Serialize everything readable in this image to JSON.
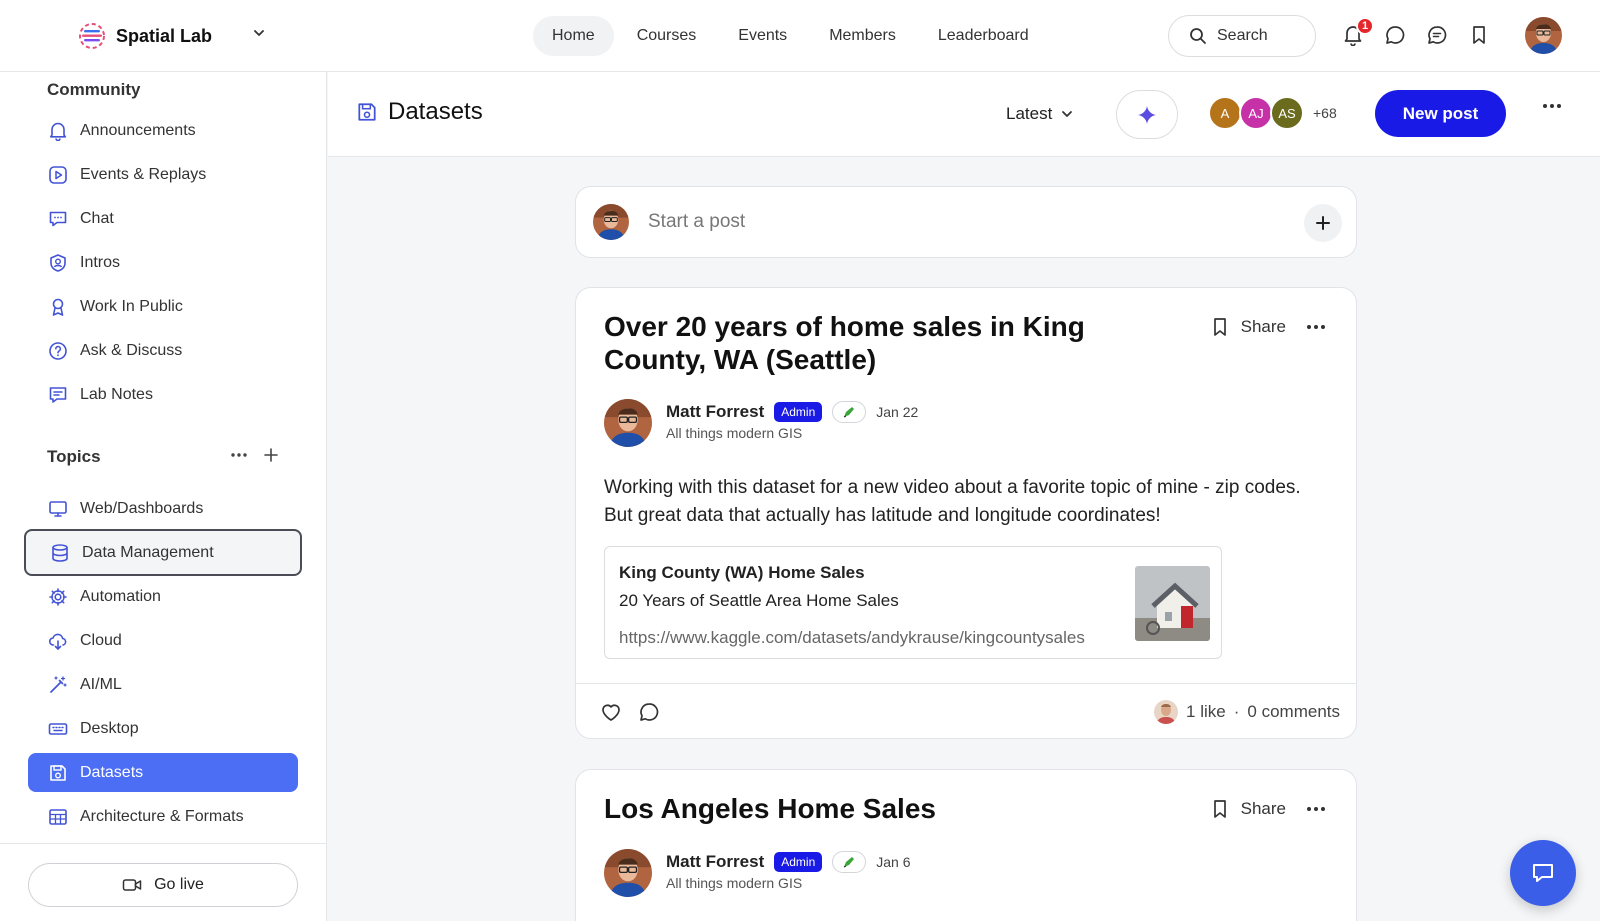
{
  "brand": {
    "name": "Spatial Lab"
  },
  "nav": [
    {
      "label": "Home"
    },
    {
      "label": "Courses"
    },
    {
      "label": "Events"
    },
    {
      "label": "Members"
    },
    {
      "label": "Leaderboard"
    }
  ],
  "search": {
    "label": "Search"
  },
  "notifications": {
    "count": "1"
  },
  "sidebar": {
    "community_heading": "Community",
    "community": [
      {
        "label": "Announcements",
        "icon": "bell-icon"
      },
      {
        "label": "Events & Replays",
        "icon": "play-icon"
      },
      {
        "label": "Chat",
        "icon": "chat-bubble-icon"
      },
      {
        "label": "Intros",
        "icon": "user-shield-icon"
      },
      {
        "label": "Work In Public",
        "icon": "ribbon-icon"
      },
      {
        "label": "Ask & Discuss",
        "icon": "question-icon"
      },
      {
        "label": "Lab Notes",
        "icon": "notes-icon"
      }
    ],
    "topics_heading": "Topics",
    "topics": [
      {
        "label": "Web/Dashboards",
        "icon": "monitor-icon"
      },
      {
        "label": "Data Management",
        "icon": "database-icon"
      },
      {
        "label": "Automation",
        "icon": "gear-icon"
      },
      {
        "label": "Cloud",
        "icon": "cloud-download-icon"
      },
      {
        "label": "AI/ML",
        "icon": "magic-wand-icon"
      },
      {
        "label": "Desktop",
        "icon": "keyboard-icon"
      },
      {
        "label": "Datasets",
        "icon": "floppy-icon"
      },
      {
        "label": "Architecture & Formats",
        "icon": "table-icon"
      }
    ],
    "go_live": "Go live"
  },
  "space": {
    "title": "Datasets",
    "sort": "Latest",
    "members": [
      {
        "initials": "A",
        "color": "#b5731a"
      },
      {
        "initials": "AJ",
        "color": "#c631a8"
      },
      {
        "initials": "AS",
        "color": "#6b6b1e"
      }
    ],
    "members_more": "+68",
    "new_post": "New post"
  },
  "composer": {
    "placeholder": "Start a post"
  },
  "posts": [
    {
      "title": "Over 20 years of home sales in King County, WA (Seattle)",
      "share": "Share",
      "author": "Matt Forrest",
      "badge": "Admin",
      "date": "Jan 22",
      "bio": "All things modern GIS",
      "body": "Working with this dataset for a new video about a favorite topic of mine - zip codes. But great data that actually has latitude and longitude coordinates!",
      "link": {
        "title": "King County (WA) Home Sales",
        "description": "20 Years of Seattle Area Home Sales",
        "url": "https://www.kaggle.com/datasets/andykrause/kingcountysales"
      },
      "likes": "1 like",
      "separator": "·",
      "comments": "0 comments"
    },
    {
      "title": "Los Angeles Home Sales",
      "share": "Share",
      "author": "Matt Forrest",
      "badge": "Admin",
      "date": "Jan 6",
      "bio": "All things modern GIS"
    }
  ],
  "colors": {
    "accent": "#1a1ae6",
    "active_sidebar": "#4b6ef5",
    "notif": "#e5262b"
  }
}
